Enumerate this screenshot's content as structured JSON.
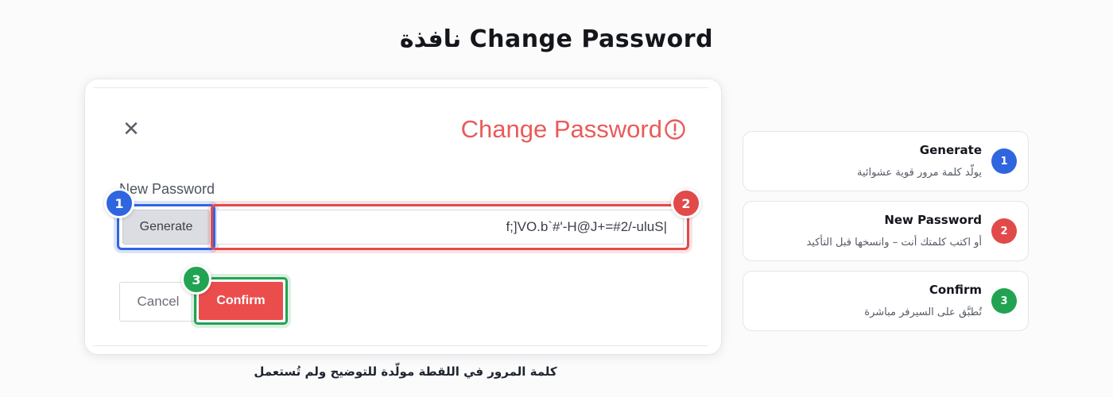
{
  "page_title": "نافذة Change Password",
  "dialog": {
    "title": "Change Password",
    "close_icon": "close-icon",
    "alert_icon": "alert-circle-icon",
    "field_label": "New Password",
    "generate_label": "Generate",
    "password_value": "f;]VO.b`#'-H@J+=#2/-uluS|",
    "cancel_label": "Cancel",
    "confirm_label": "Confirm"
  },
  "badges": [
    "1",
    "2",
    "3"
  ],
  "caption": "كلمة المرور في اللقطة مولّدة للتوضيح ولم تُستعمل",
  "legend": [
    {
      "number": "1",
      "title": "Generate",
      "desc": "يولّد كلمة مرور قوية عشوائية",
      "color": "#2f66e0"
    },
    {
      "number": "2",
      "title": "New Password",
      "desc": "أو اكتب كلمتك أنت – وانسخها قبل التأكيد",
      "color": "#e24a4a"
    },
    {
      "number": "3",
      "title": "Confirm",
      "desc": "تُطبَّق على السيرفر مباشرة",
      "color": "#22a352"
    }
  ],
  "colors": {
    "accent_red": "#ea5a5a",
    "highlight_blue": "#2f66e0",
    "highlight_red": "#e24a4a",
    "highlight_green": "#22a352"
  }
}
